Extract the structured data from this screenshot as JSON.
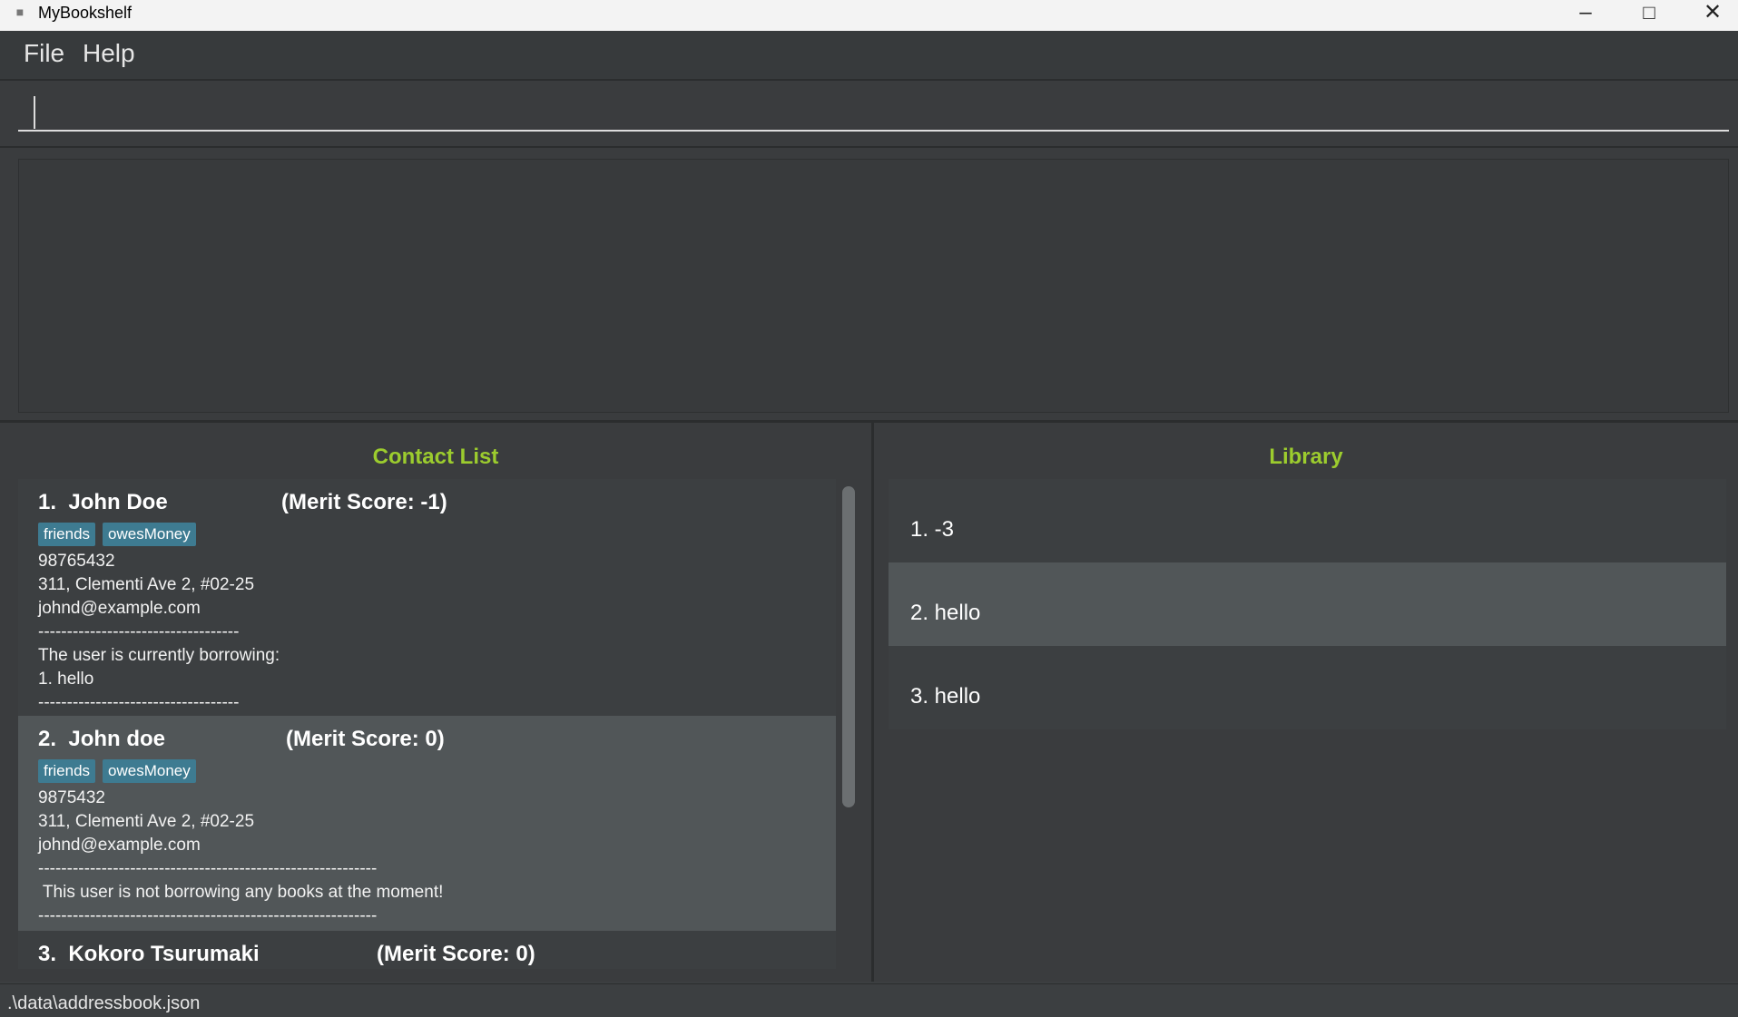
{
  "window": {
    "title": "MyBookshelf"
  },
  "menu": {
    "file": "File",
    "help": "Help"
  },
  "command": {
    "value": ""
  },
  "result": {
    "text": ""
  },
  "contacts": {
    "title": "Contact List",
    "items": [
      {
        "head": "1.  John Doe",
        "merit": "(Merit Score: -1)",
        "tags": [
          "friends",
          "owesMoney"
        ],
        "phone": "98765432",
        "address": "311, Clementi Ave 2, #02-25",
        "email": "johnd@example.com",
        "sep1": "-----------------------------------",
        "borrow_line1": "The user is currently borrowing:",
        "borrow_line2": "1. hello",
        "sep2": "-----------------------------------"
      },
      {
        "head": "2.  John doe",
        "merit": "(Merit Score: 0)",
        "tags": [
          "friends",
          "owesMoney"
        ],
        "phone": "9875432",
        "address": "311, Clementi Ave 2, #02-25",
        "email": "johnd@example.com",
        "sep1": "-----------------------------------------------------------",
        "borrow_line1": " This user is not borrowing any books at the moment!",
        "sep2": "-----------------------------------------------------------"
      },
      {
        "head": "3.  Kokoro Tsurumaki",
        "merit": "(Merit Score: 0)"
      }
    ]
  },
  "library": {
    "title": "Library",
    "items": [
      "1. -3",
      "2. hello",
      "3. hello"
    ]
  },
  "status": {
    "path": ".\\data\\addressbook.json"
  }
}
